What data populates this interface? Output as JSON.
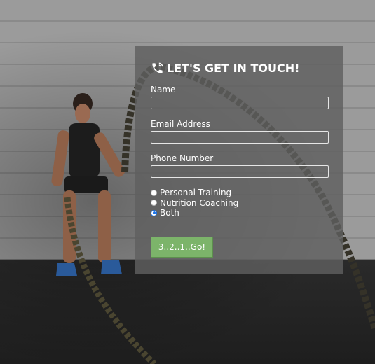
{
  "form": {
    "title": "LET'S GET IN TOUCH!",
    "title_icon": "phone-icon",
    "fields": [
      {
        "label": "Name",
        "value": ""
      },
      {
        "label": "Email Address",
        "value": ""
      },
      {
        "label": "Phone Number",
        "value": ""
      }
    ],
    "options": [
      {
        "label": "Personal Training",
        "checked": false
      },
      {
        "label": "Nutrition Coaching",
        "checked": false
      },
      {
        "label": "Both",
        "checked": true
      }
    ],
    "submit_label": "3..2..1..Go!"
  },
  "colors": {
    "button_green": "#7cb46a",
    "radio_selected": "#1a73e8",
    "panel": "#5f5f5f"
  }
}
